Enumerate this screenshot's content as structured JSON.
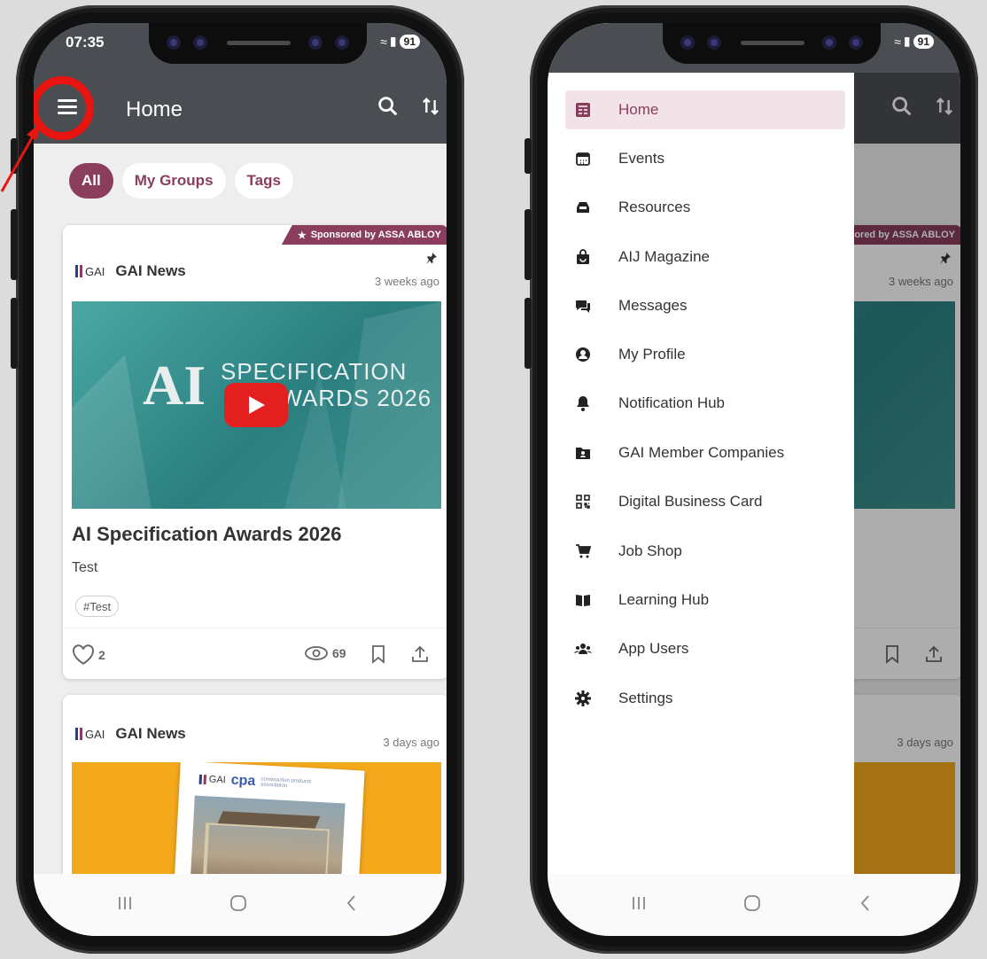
{
  "left_phone": {
    "status": {
      "time": "07:35",
      "battery": "91"
    },
    "app_title": "Home",
    "filters": [
      {
        "label": "All",
        "active": true
      },
      {
        "label": "My Groups",
        "active": false
      },
      {
        "label": "Tags",
        "active": false
      }
    ],
    "post1": {
      "sponsor": "Sponsored by ASSA ABLOY",
      "logo": "GAI",
      "source": "GAI News",
      "time": "3 weeks ago",
      "media_big": "AI",
      "media_line1": "SPECIFICATION",
      "media_line2": "AWARDS 2026",
      "title": "AI Specification Awards 2026",
      "body": "Test",
      "tag": "#Test",
      "likes": "2",
      "views": "69"
    },
    "post2": {
      "logo": "GAI",
      "source": "GAI News",
      "time": "3 days ago",
      "doc_logo": "GAI",
      "doc_brand": "cpa",
      "doc_brand_sub": "construction products association"
    }
  },
  "right_phone": {
    "status": {
      "battery": "91"
    },
    "sponsor_fragment": "ored by ASSA ABLOY",
    "time1": "3 weeks ago",
    "time2": "3 days ago",
    "drawer": [
      {
        "label": "Home",
        "icon": "newspaper-icon",
        "active": true
      },
      {
        "label": "Events",
        "icon": "calendar-icon",
        "active": false
      },
      {
        "label": "Resources",
        "icon": "inbox-icon",
        "active": false
      },
      {
        "label": "AIJ Magazine",
        "icon": "shopping-bag-icon",
        "active": false
      },
      {
        "label": "Messages",
        "icon": "comments-icon",
        "active": false
      },
      {
        "label": "My Profile",
        "icon": "user-circle-icon",
        "active": false
      },
      {
        "label": "Notification Hub",
        "icon": "bell-icon",
        "active": false
      },
      {
        "label": "GAI Member Companies",
        "icon": "folder-user-icon",
        "active": false
      },
      {
        "label": "Digital Business Card",
        "icon": "qr-code-icon",
        "active": false
      },
      {
        "label": "Job Shop",
        "icon": "cart-icon",
        "active": false
      },
      {
        "label": "Learning Hub",
        "icon": "book-open-icon",
        "active": false
      },
      {
        "label": "App Users",
        "icon": "users-icon",
        "active": false
      },
      {
        "label": "Settings",
        "icon": "gear-icon",
        "active": false
      }
    ]
  },
  "colors": {
    "brand": "#8a3d5c",
    "appbar": "#4a4d52",
    "highlight": "#e8140f"
  }
}
